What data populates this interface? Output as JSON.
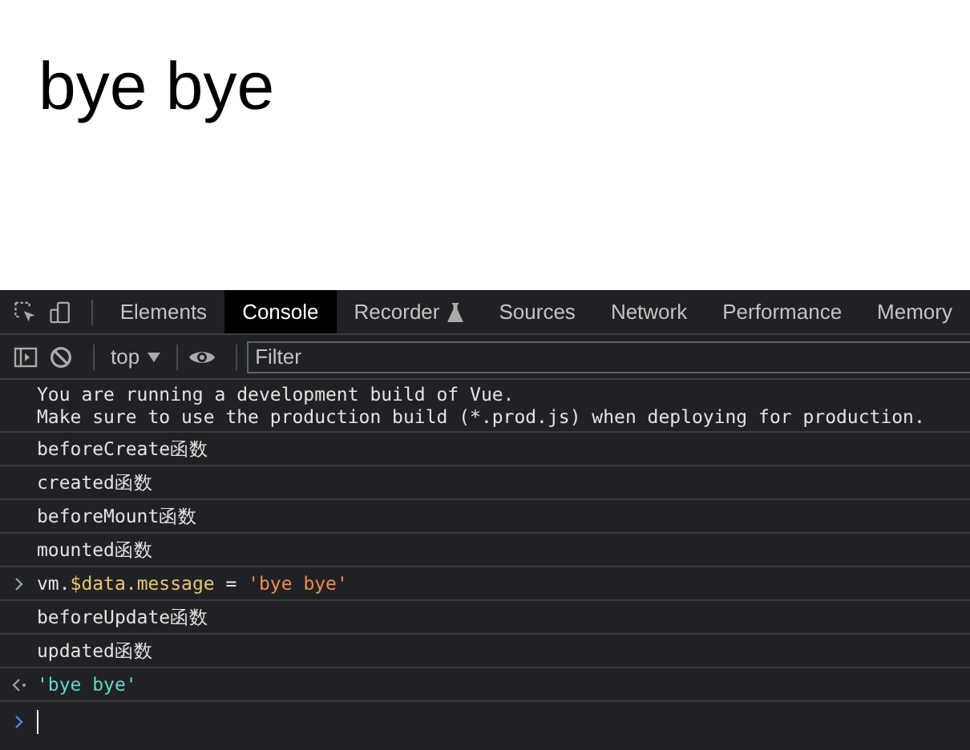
{
  "page": {
    "heading": "bye bye"
  },
  "devtools": {
    "tabs": [
      {
        "label": "Elements",
        "selected": false,
        "kind": "plain"
      },
      {
        "label": "Console",
        "selected": true,
        "kind": "plain"
      },
      {
        "label": "Recorder",
        "selected": false,
        "kind": "experimental"
      },
      {
        "label": "Sources",
        "selected": false,
        "kind": "plain"
      },
      {
        "label": "Network",
        "selected": false,
        "kind": "plain"
      },
      {
        "label": "Performance",
        "selected": false,
        "kind": "plain"
      },
      {
        "label": "Memory",
        "selected": false,
        "kind": "plain"
      }
    ],
    "toolbar": {
      "context": "top",
      "filter": {
        "placeholder": "Filter"
      }
    },
    "console": [
      {
        "kind": "log",
        "lines": [
          "You are running a development build of Vue.",
          "Make sure to use the production build (*.prod.js) when deploying for production."
        ]
      },
      {
        "kind": "log",
        "lines": [
          "beforeCreate函数"
        ]
      },
      {
        "kind": "log",
        "lines": [
          "created函数"
        ]
      },
      {
        "kind": "log",
        "lines": [
          "beforeMount函数"
        ]
      },
      {
        "kind": "log",
        "lines": [
          "mounted函数"
        ]
      },
      {
        "kind": "input",
        "tokens": [
          {
            "text": "vm.",
            "kind": "plain"
          },
          {
            "text": "$data.message",
            "kind": "property"
          },
          {
            "text": " = ",
            "kind": "plain"
          },
          {
            "text": "'bye bye'",
            "kind": "string"
          }
        ]
      },
      {
        "kind": "log",
        "lines": [
          "beforeUpdate函数"
        ]
      },
      {
        "kind": "log",
        "lines": [
          "updated函数"
        ]
      },
      {
        "kind": "result",
        "lines": [
          "'bye bye'"
        ]
      },
      {
        "kind": "prompt"
      }
    ]
  }
}
